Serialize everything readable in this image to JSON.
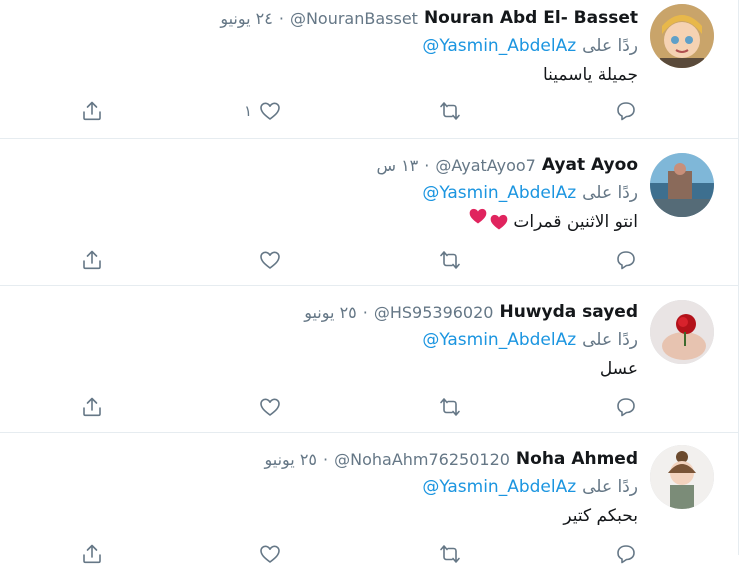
{
  "tweets": [
    {
      "name": "Nouran Abd El- Basset",
      "handle": "@NouranBasset",
      "separator": "·",
      "time": "٢٤ يونيو",
      "reply_prefix": "ردًا على",
      "reply_user": "@Yasmin_AbdelAz",
      "text": "جميلة ياسمينا",
      "like_count": "١",
      "avatar_icon": "cartoon-girl-avatar"
    },
    {
      "name": "Ayat Ayoo",
      "handle": "@AyatAyoo7",
      "separator": "·",
      "time": "١٣ س",
      "reply_prefix": "ردًا على",
      "reply_user": "@Yasmin_AbdelAz",
      "text": "انتو الاثنين قمرات",
      "like_count": "",
      "avatar_icon": "sea-photo-avatar"
    },
    {
      "name": "Huwyda sayed",
      "handle": "@HS95396020",
      "separator": "·",
      "time": "٢٥ يونيو",
      "reply_prefix": "ردًا على",
      "reply_user": "@Yasmin_AbdelAz",
      "text": "عسل",
      "like_count": "",
      "avatar_icon": "rose-hands-avatar"
    },
    {
      "name": "Noha Ahmed",
      "handle": "@NohaAhm76250120",
      "separator": "·",
      "time": "٢٥ يونيو",
      "reply_prefix": "ردًا على",
      "reply_user": "@Yasmin_AbdelAz",
      "text": "بحبكم كتير",
      "like_count": "",
      "avatar_icon": "girl-illustration-avatar"
    }
  ],
  "colors": {
    "link": "#1b95e0",
    "muted": "#657786",
    "divider": "#e6ecf0",
    "heart_emoji": "#e0245e"
  }
}
